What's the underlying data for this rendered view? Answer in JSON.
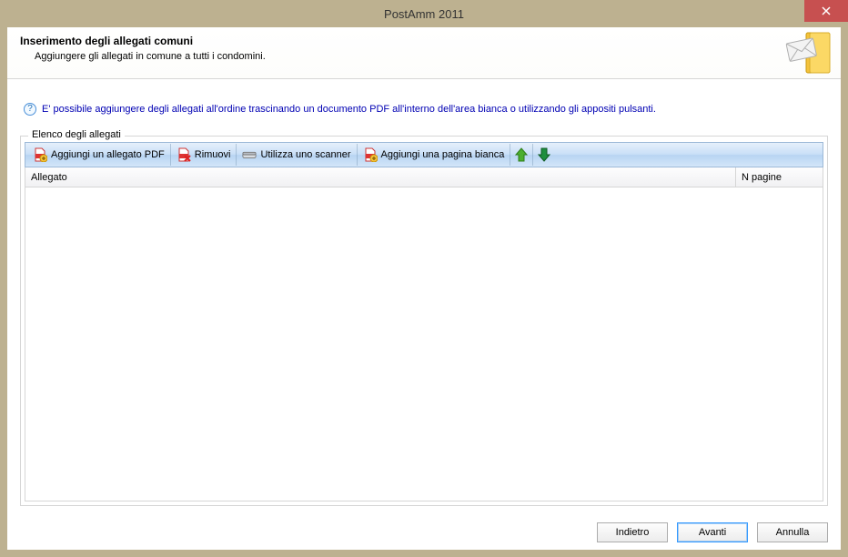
{
  "window": {
    "title": "PostAmm 2011"
  },
  "header": {
    "title": "Inserimento degli allegati comuni",
    "subtitle": "Aggiungere gli allegati in comune a tutti i condomini."
  },
  "info": {
    "text": "E' possibile aggiungere degli allegati all'ordine trascinando un documento PDF all'interno dell'area bianca o utilizzando gli appositi pulsanti."
  },
  "group": {
    "label": "Elenco degli allegati"
  },
  "toolbar": {
    "add_pdf": "Aggiungi un allegato PDF",
    "remove": "Rimuovi",
    "scanner": "Utilizza uno scanner",
    "add_blank": "Aggiungi una pagina bianca"
  },
  "table": {
    "col_allegato": "Allegato",
    "col_pagine": "N pagine",
    "rows": []
  },
  "footer": {
    "back": "Indietro",
    "next": "Avanti",
    "cancel": "Annulla"
  }
}
